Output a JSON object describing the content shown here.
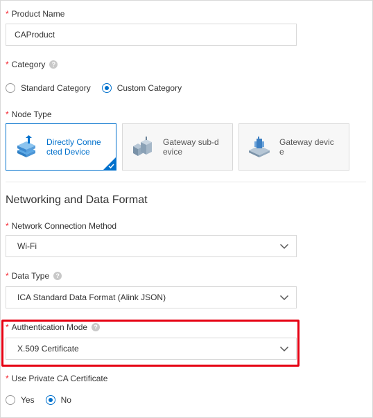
{
  "product_name": {
    "label": "Product Name",
    "value": "CAProduct"
  },
  "category": {
    "label": "Category",
    "options": [
      "Standard Category",
      "Custom Category"
    ],
    "selected": "Custom Category"
  },
  "node_type": {
    "label": "Node Type",
    "cards": [
      {
        "label": "Directly Connected Device",
        "selected": true
      },
      {
        "label": "Gateway sub-device",
        "selected": false
      },
      {
        "label": "Gateway device",
        "selected": false
      }
    ]
  },
  "section": {
    "title": "Networking and Data Format"
  },
  "network": {
    "label": "Network Connection Method",
    "value": "Wi-Fi"
  },
  "data_type": {
    "label": "Data Type",
    "value": "ICA Standard Data Format (Alink JSON)"
  },
  "auth_mode": {
    "label": "Authentication Mode",
    "value": "X.509 Certificate"
  },
  "private_ca": {
    "label": "Use Private CA Certificate",
    "options": [
      "Yes",
      "No"
    ],
    "selected": "No"
  },
  "colors": {
    "accent": "#0070cc",
    "required": "#f5222d",
    "highlight": "#e60012"
  },
  "icons": {
    "help": "question-icon",
    "dropdown": "chevron-down-icon",
    "check": "check-icon"
  }
}
